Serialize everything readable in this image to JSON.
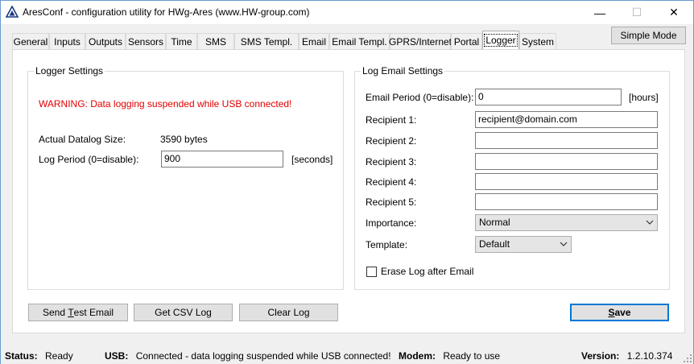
{
  "window": {
    "title": "AresConf - configuration utility for HWg-Ares (www.HW-group.com)",
    "minimize_glyph": "—",
    "maximize_glyph": "☐",
    "close_glyph": "✕"
  },
  "tabs": [
    {
      "label": "General"
    },
    {
      "label": "Inputs"
    },
    {
      "label": "Outputs"
    },
    {
      "label": "Sensors"
    },
    {
      "label": "Time"
    },
    {
      "label": "SMS"
    },
    {
      "label": "SMS Templ."
    },
    {
      "label": "Email"
    },
    {
      "label": "Email Templ."
    },
    {
      "label": "GPRS/Internet"
    },
    {
      "label": "Portal"
    },
    {
      "label": "Logger"
    },
    {
      "label": "System"
    }
  ],
  "active_tab": "Logger",
  "simple_mode_label": "Simple Mode",
  "logger_settings": {
    "title": "Logger Settings",
    "warning": "WARNING: Data logging suspended while USB connected!",
    "datalog_size_label": "Actual Datalog Size:",
    "datalog_size_value": "3590 bytes",
    "log_period_label": "Log Period (0=disable):",
    "log_period_value": "900",
    "log_period_unit": "[seconds]"
  },
  "log_email_settings": {
    "title": "Log Email Settings",
    "email_period_label": "Email Period (0=disable):",
    "email_period_value": "0",
    "email_period_unit": "[hours]",
    "recipient1_label": "Recipient 1:",
    "recipient1_value": "recipient@domain.com",
    "recipient2_label": "Recipient 2:",
    "recipient2_value": "",
    "recipient3_label": "Recipient 3:",
    "recipient3_value": "",
    "recipient4_label": "Recipient 4:",
    "recipient4_value": "",
    "recipient5_label": "Recipient 5:",
    "recipient5_value": "",
    "importance_label": "Importance:",
    "importance_value": "Normal",
    "template_label": "Template:",
    "template_value": "Default",
    "erase_log_label": "Erase Log after Email",
    "erase_log_checked": false
  },
  "buttons": {
    "send_test_email_pre": "Send ",
    "send_test_email_accel": "T",
    "send_test_email_post": "est Email",
    "get_csv_log": "Get CSV Log",
    "clear_log": "Clear Log",
    "save_accel": "S",
    "save_post": "ave"
  },
  "statusbar": {
    "status_label": "Status:",
    "status_value": "Ready",
    "usb_label": "USB:",
    "usb_value": "Connected - data logging suspended while USB connected!",
    "modem_label": "Modem:",
    "modem_value": "Ready to use",
    "version_label": "Version:",
    "version_value": "1.2.10.374"
  },
  "colors": {
    "warning": "#e00000",
    "default_button_border": "#0078d7",
    "window_border": "#6b9bd1"
  },
  "icons": {
    "app": "ares-triangle-icon",
    "dropdown": "chevron-down-icon",
    "grip": "resize-grip-icon"
  }
}
